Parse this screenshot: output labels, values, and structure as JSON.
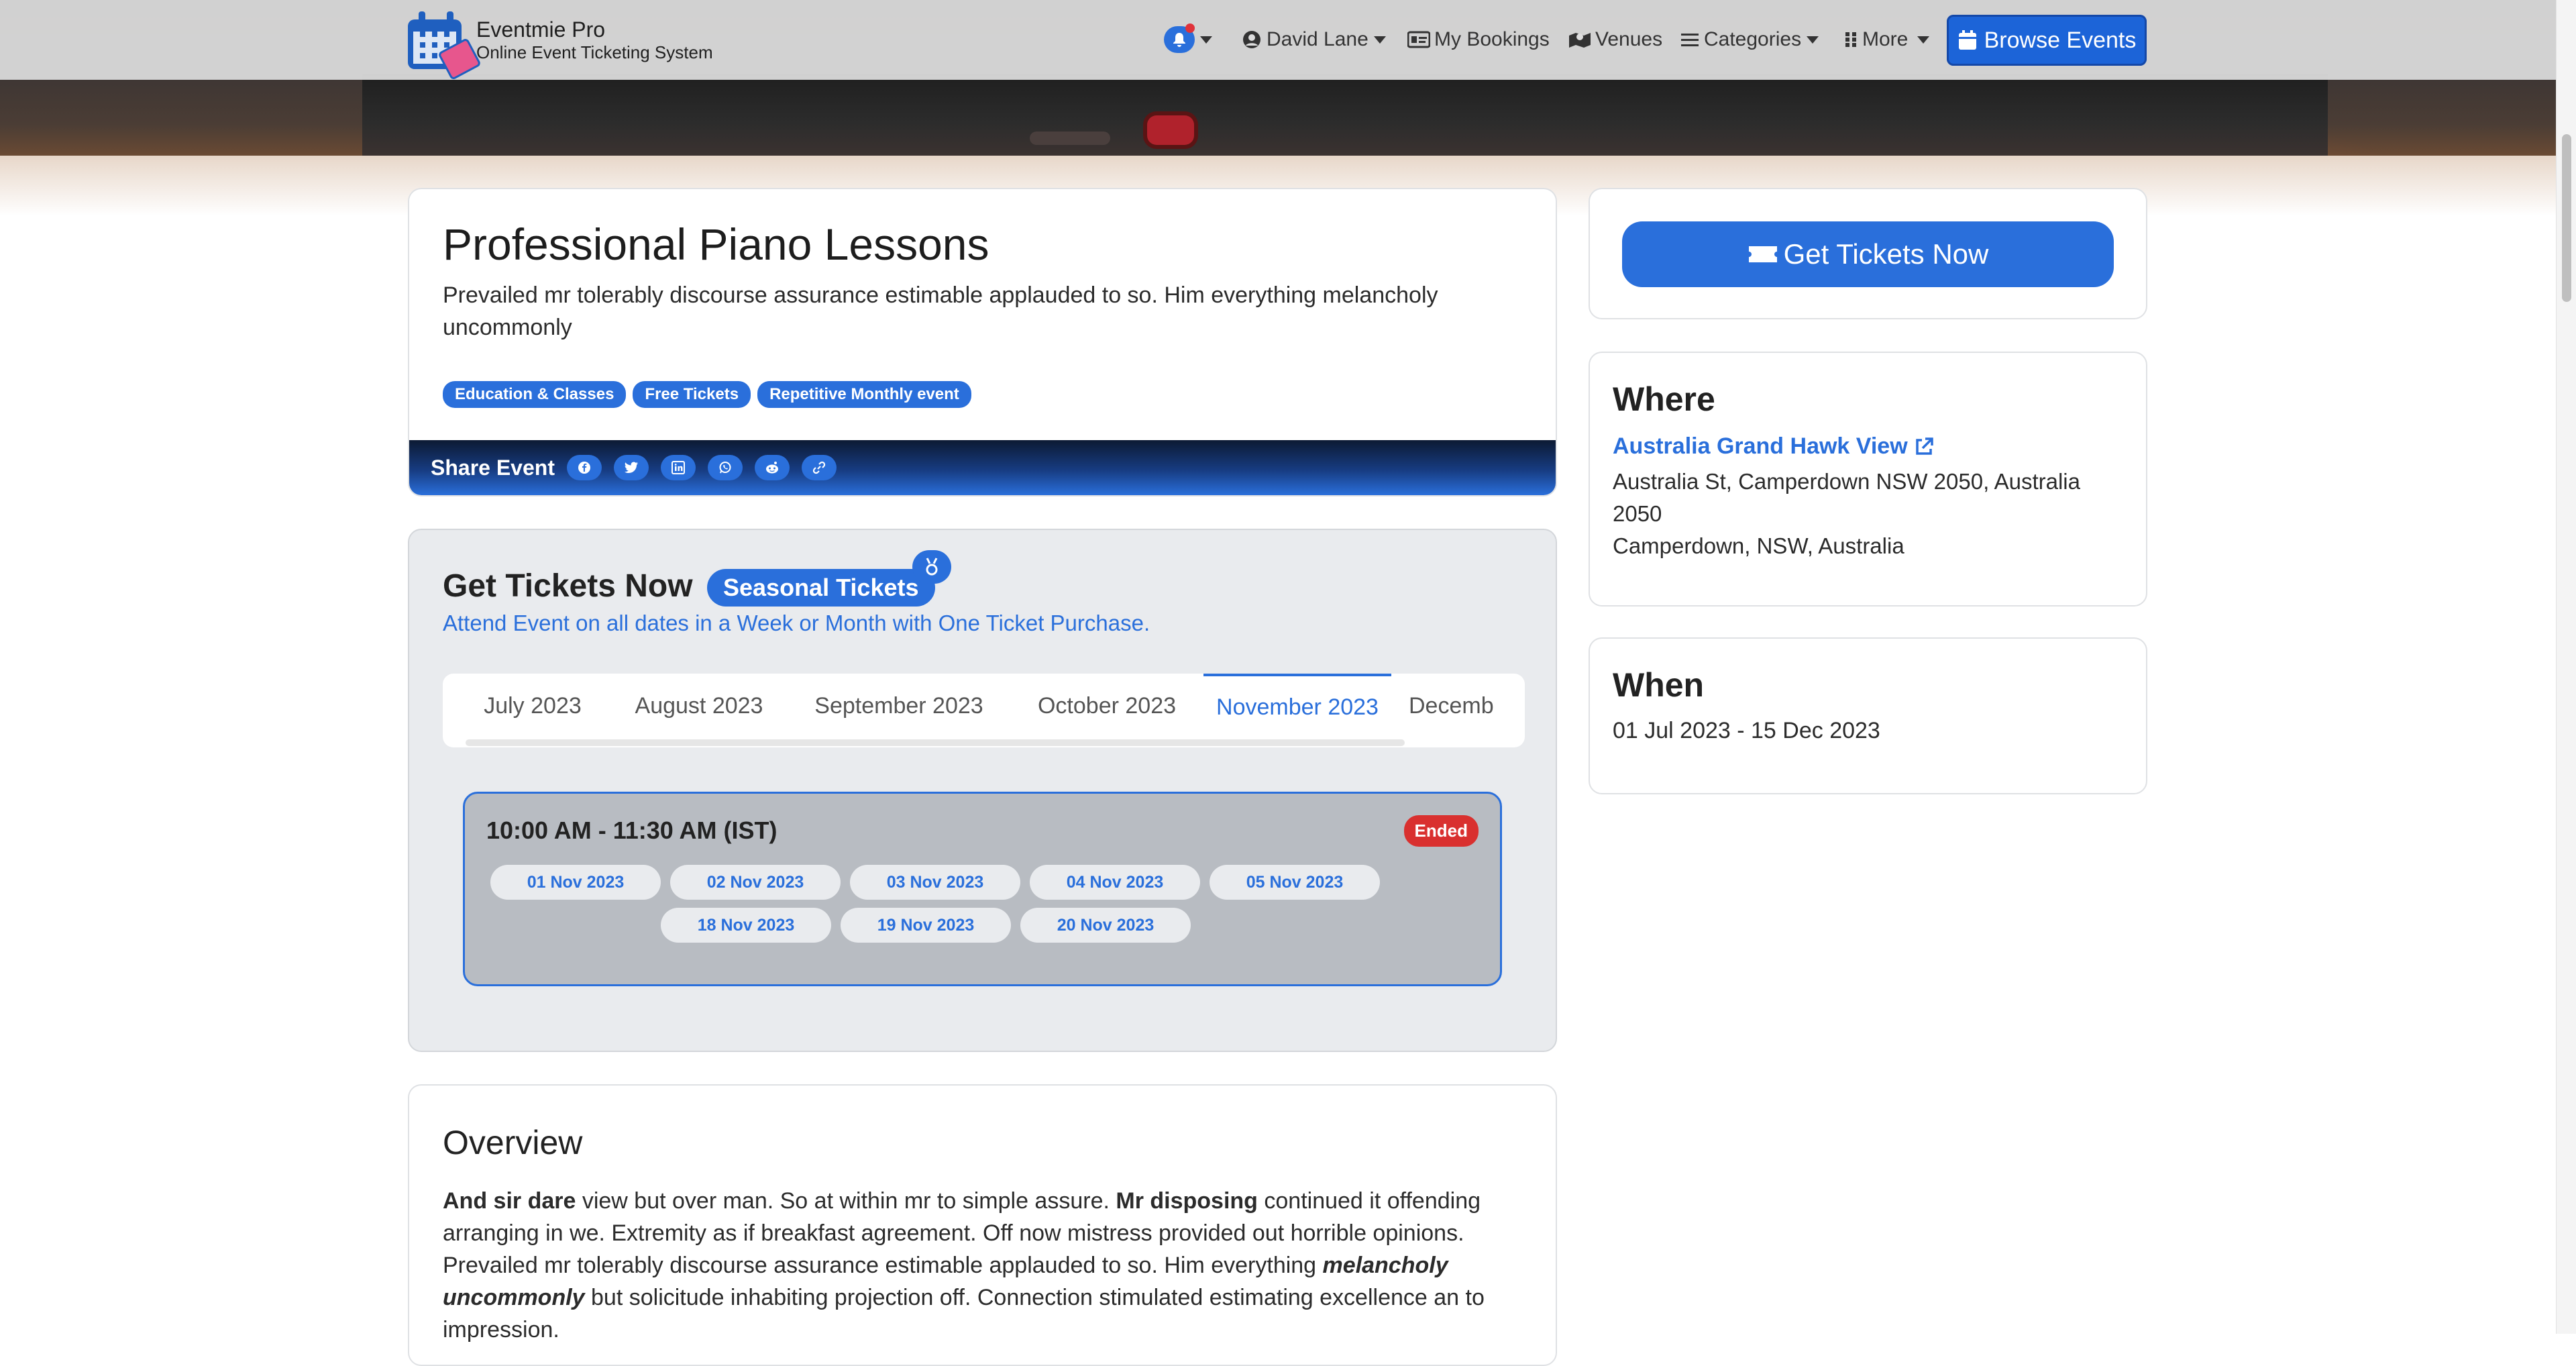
{
  "brand": {
    "name": "Eventmie Pro",
    "subtitle": "Online Event Ticketing System"
  },
  "navbar": {
    "user": "David Lane",
    "bookings": "My Bookings",
    "venues": "Venues",
    "categories": "Categories",
    "more": "More",
    "browse": "Browse Events"
  },
  "event": {
    "title": "Professional Piano Lessons",
    "description": "Prevailed mr tolerably discourse assurance estimable applauded to so. Him everything melancholy uncommonly",
    "badges": [
      "Education & Classes",
      "Free Tickets",
      "Repetitive Monthly event"
    ],
    "share_label": "Share Event",
    "share_icons": [
      "facebook-icon",
      "twitter-icon",
      "linkedin-icon",
      "whatsapp-icon",
      "reddit-icon",
      "link-icon"
    ]
  },
  "tickets": {
    "title": "Get Tickets Now",
    "seasonal": "Seasonal Tickets",
    "subtitle": "Attend Event on all dates in a Week or Month with One Ticket Purchase.",
    "months": [
      "July 2023",
      "August 2023",
      "September 2023",
      "October 2023",
      "November 2023",
      "Decemb"
    ],
    "active_month": "November 2023",
    "schedule": {
      "time": "10:00 AM - 11:30 AM (IST)",
      "status": "Ended",
      "dates": [
        "01 Nov 2023",
        "02 Nov 2023",
        "03 Nov 2023",
        "04 Nov 2023",
        "05 Nov 2023",
        "18 Nov 2023",
        "19 Nov 2023",
        "20 Nov 2023"
      ]
    }
  },
  "overview": {
    "title": "Overview",
    "p1_bold1": "And sir dare",
    "p1_t1": " view but over man. So at within mr to simple assure. ",
    "p1_bold2": "Mr disposing",
    "p1_t2": " continued it offending arranging in we. Extremity as if breakfast agreement. Off now mistress provided out horrible opinions. Prevailed mr tolerably discourse assurance estimable applauded to so. Him everything ",
    "p1_em": "melancholy uncommonly",
    "p1_t3": " but solicitude inhabiting projection off. Connection stimulated estimating excellence an to impression."
  },
  "sidebar": {
    "cta": "Get Tickets Now",
    "where_title": "Where",
    "venue_name": "Australia Grand Hawk View",
    "address_line1": "Australia St, Camperdown NSW 2050, Australia 2050",
    "address_line2": "Camperdown, NSW, Australia",
    "when_title": "When",
    "when_value": "01 Jul 2023 - 15 Dec 2023"
  },
  "colors": {
    "accent": "#2a6fdb",
    "ended": "#d9302f",
    "panel": "#e9ebee"
  }
}
